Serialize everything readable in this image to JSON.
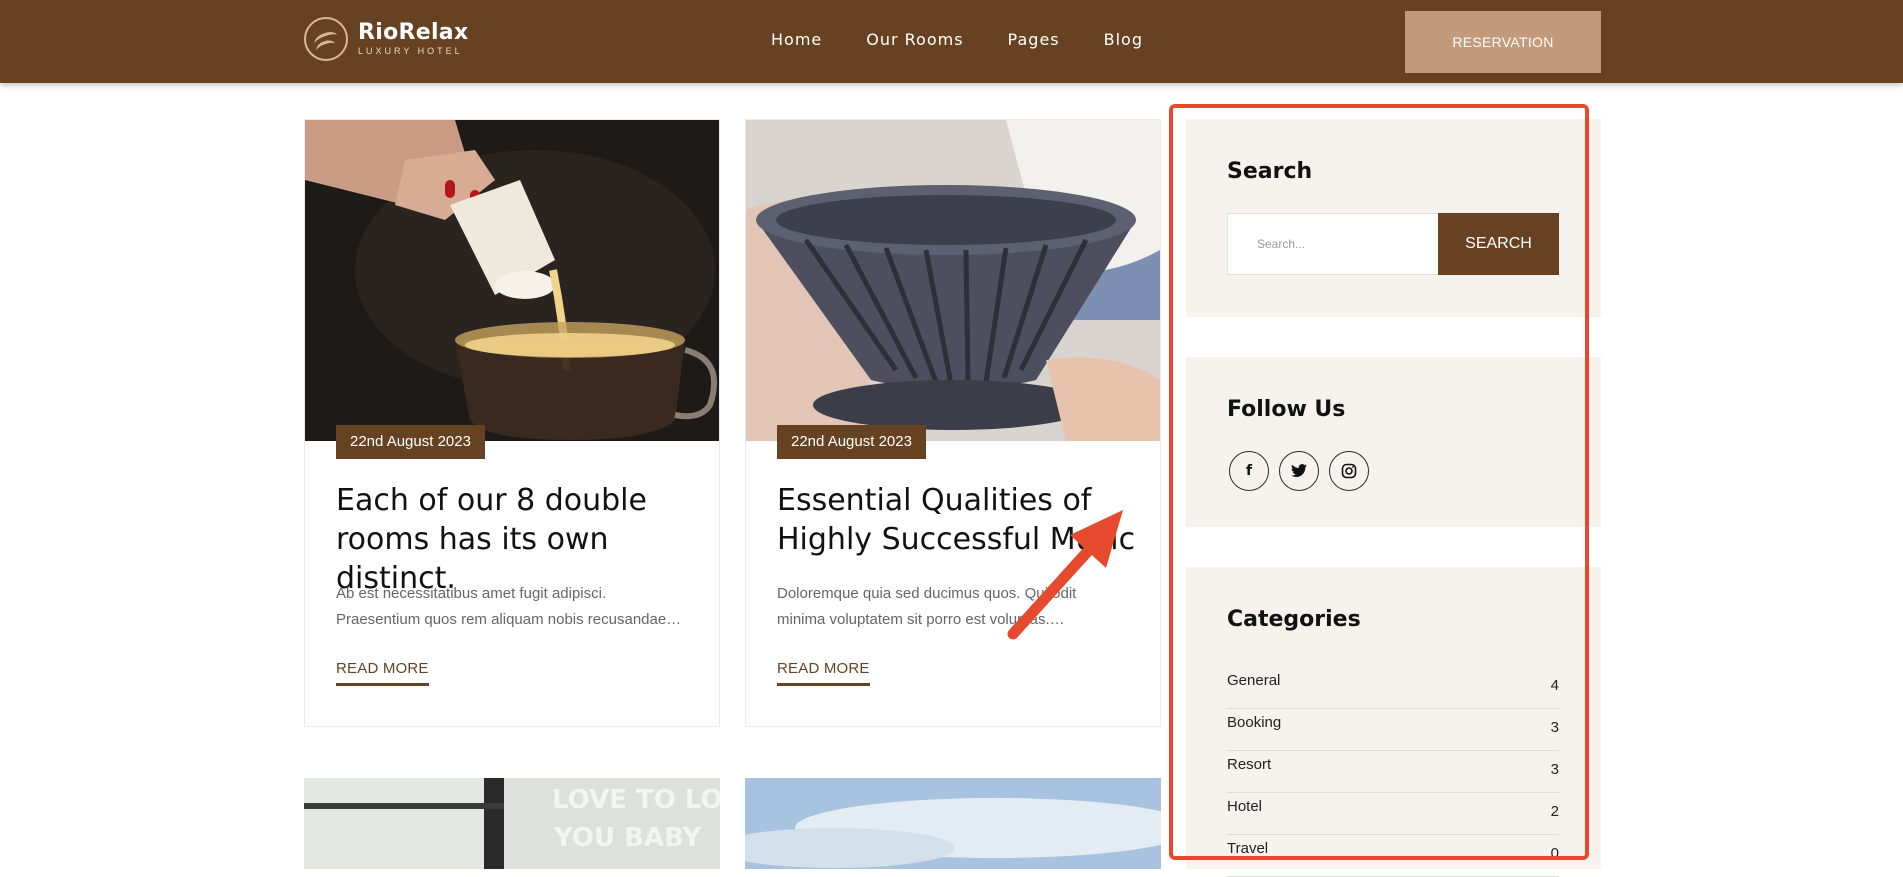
{
  "header": {
    "logo_name": "RioRelax",
    "logo_sub": "LUXURY HOTEL",
    "nav": [
      "Home",
      "Our Rooms",
      "Pages",
      "Blog"
    ],
    "reservation_label": "RESERVATION"
  },
  "posts": [
    {
      "date": "22nd August 2023",
      "title": "Each of our 8 double\nrooms has its own distinct.",
      "excerpt": "Ab est necessitatibus amet fugit adipisci.\nPraesentium quos rem aliquam nobis recusandae…",
      "read_more": "READ MORE"
    },
    {
      "date": "22nd August 2023",
      "title": "Essential Qualities of\nHighly Successful Music",
      "excerpt": "Doloremque quia sed ducimus quos. Qui odit\nminima voluptatem sit porro est voluptas.…",
      "read_more": "READ MORE"
    }
  ],
  "next_posts": [
    {
      "image_text": "LOVE TO LOVE\nYOU BABY"
    },
    {
      "image_text": ""
    }
  ],
  "sidebar": {
    "search": {
      "title": "Search",
      "placeholder": "Search...",
      "button": "SEARCH"
    },
    "follow": {
      "title": "Follow Us",
      "icons": [
        "facebook-icon",
        "twitter-icon",
        "instagram-icon"
      ]
    },
    "categories": {
      "title": "Categories",
      "items": [
        {
          "name": "General",
          "count": "4"
        },
        {
          "name": "Booking",
          "count": "3"
        },
        {
          "name": "Resort",
          "count": "3"
        },
        {
          "name": "Hotel",
          "count": "2"
        },
        {
          "name": "Travel",
          "count": "0"
        }
      ]
    }
  },
  "colors": {
    "brand_brown": "#664222",
    "accent_tan": "#c19a7b",
    "sidebar_bg": "#f6f3ef",
    "annotation_red": "#e64a2e"
  }
}
